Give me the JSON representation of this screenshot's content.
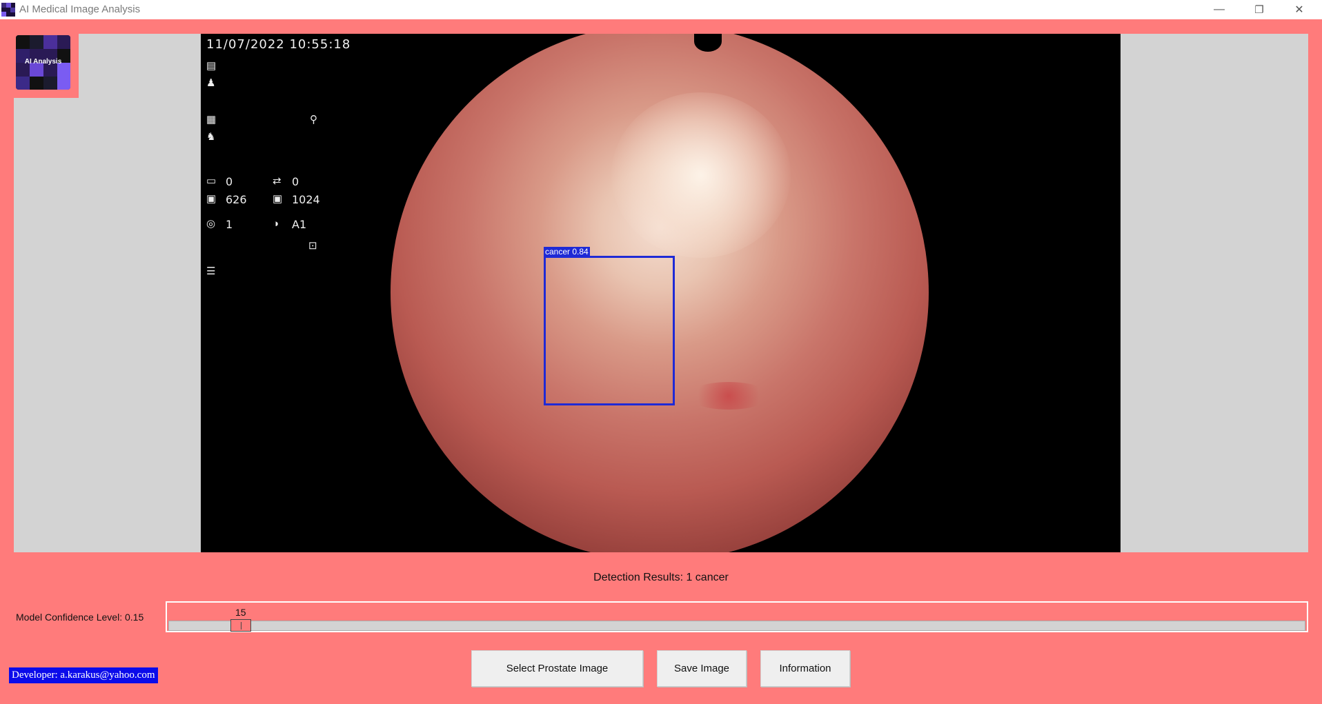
{
  "window": {
    "title": "AI Medical Image Analysis",
    "controls": {
      "minimize": "—",
      "restore": "❐",
      "close": "✕"
    }
  },
  "logo": {
    "label": "AI Analysis"
  },
  "viewer": {
    "osd": {
      "datetime": "11/07/2022   10:55:18",
      "val_a": "0",
      "val_b": "0",
      "val_c": "626",
      "val_d": "1024",
      "val_e": "1",
      "val_f": "A1"
    },
    "detection": {
      "label": "cancer 0.84",
      "color": "#1e2ad6"
    }
  },
  "results": {
    "text": "Detection Results: 1 cancer"
  },
  "confidence": {
    "label": "Model Confidence Level: 0.15",
    "slider_value": "15",
    "level_fraction": 0.15
  },
  "buttons": {
    "select": "Select  Prostate Image",
    "save": "Save Image",
    "info": "Information"
  },
  "developer": {
    "text": "Developer: a.karakus@yahoo.com"
  },
  "colors": {
    "background": "#ff7b7b",
    "panel": "#d3d3d3",
    "detection_box": "#1e2ad6",
    "developer_bg": "#0b0bea"
  }
}
